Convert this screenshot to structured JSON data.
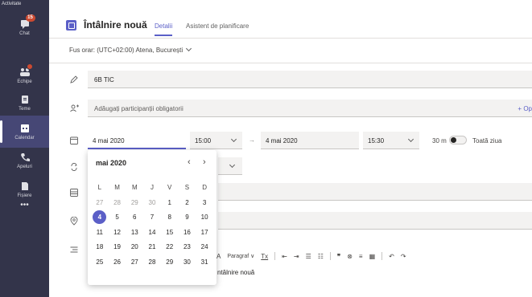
{
  "rail": {
    "top_label": "Activitate",
    "items": [
      {
        "label": "Chat",
        "badge": "15",
        "icon": "chat-icon"
      },
      {
        "label": "Echipe",
        "icon": "teams-icon",
        "dot": true
      },
      {
        "label": "Teme",
        "icon": "assignments-icon"
      },
      {
        "label": "Calendar",
        "icon": "calendar-icon",
        "active": true
      },
      {
        "label": "Apeluri",
        "icon": "phone-icon"
      },
      {
        "label": "Fișiere",
        "icon": "files-icon"
      },
      {
        "label": "•••",
        "icon": "more-icon"
      }
    ]
  },
  "header": {
    "title": "Întâlnire nouă",
    "tabs": [
      {
        "label": "Detalii",
        "active": true
      },
      {
        "label": "Asistent de planificare",
        "active": false
      }
    ]
  },
  "timezone": {
    "label": "Fus orar: (UTC+02:00) Atena, București"
  },
  "title_field": {
    "value": "6B TIC"
  },
  "attendees": {
    "placeholder": "Adăugați participanții obligatorii",
    "optional_link": "+ Op"
  },
  "datetime": {
    "start_date": "4 mai 2020",
    "start_time": "15:00",
    "end_date": "4 mai 2020",
    "end_time": "15:30",
    "arrow": "→",
    "duration": "30 m",
    "all_day_label": "Toată ziua",
    "all_day_on": false
  },
  "calendar": {
    "month_label": "mai 2020",
    "prev": "‹",
    "next": "›",
    "weekdays": [
      "L",
      "M",
      "M",
      "J",
      "V",
      "S",
      "D"
    ],
    "weeks": [
      [
        "27",
        "28",
        "29",
        "30",
        "1",
        "2",
        "3"
      ],
      [
        "4",
        "5",
        "6",
        "7",
        "8",
        "9",
        "10"
      ],
      [
        "11",
        "12",
        "13",
        "14",
        "15",
        "16",
        "17"
      ],
      [
        "18",
        "19",
        "20",
        "21",
        "22",
        "23",
        "24"
      ],
      [
        "25",
        "26",
        "27",
        "28",
        "29",
        "30",
        "31"
      ]
    ],
    "selected": "4",
    "prev_month_days": 4
  },
  "toolbar": {
    "font_color": "A",
    "paragraph": "Paragraf ∨",
    "clear_format": "Tx",
    "indent_out": "⇤",
    "indent_in": "⇥",
    "bullets": "☰",
    "numbers": "☷",
    "quote": "❞",
    "link": "⊗",
    "align": "≡",
    "table": "▦",
    "undo": "↶",
    "redo": "↷"
  },
  "editor": {
    "text": "ntâlnire nouă"
  },
  "colors": {
    "accent": "#5b5fc7",
    "rail": "#33344a",
    "badge": "#cc4a31"
  }
}
